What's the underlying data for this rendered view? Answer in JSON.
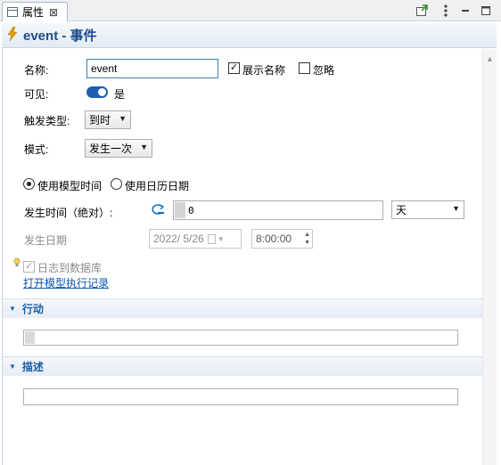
{
  "tab": {
    "label": "属性",
    "close": "⊠"
  },
  "header": {
    "title": "event - 事件"
  },
  "form": {
    "name_label": "名称:",
    "name_value": "event",
    "show_name_label": "展示名称",
    "show_name_checked": true,
    "ignore_label": "忽略",
    "ignore_checked": false,
    "visible_label": "可见:",
    "visible_value": "是",
    "trigger_type_label": "触发类型:",
    "trigger_type_value": "到时",
    "mode_label": "模式:",
    "mode_value": "发生一次",
    "use_model_time_label": "使用模型时间",
    "use_calendar_label": "使用日历日期",
    "selected_time_mode": "model",
    "occur_time_label": "发生时间（绝对）:",
    "occur_time_value": "0",
    "occur_time_unit": "天",
    "occur_date_label": "发生日期",
    "occur_date_value": "2022/  5/26",
    "occur_clock_value": "8:00:00",
    "log_db_label": "日志到数据库",
    "log_db_checked": true,
    "open_log_link": "打开模型执行记录"
  },
  "sections": {
    "action": "行动",
    "description": "描述"
  },
  "colors": {
    "accent": "#1a5ea8",
    "title": "#1a4d8c",
    "bolt": "#e0a000"
  }
}
